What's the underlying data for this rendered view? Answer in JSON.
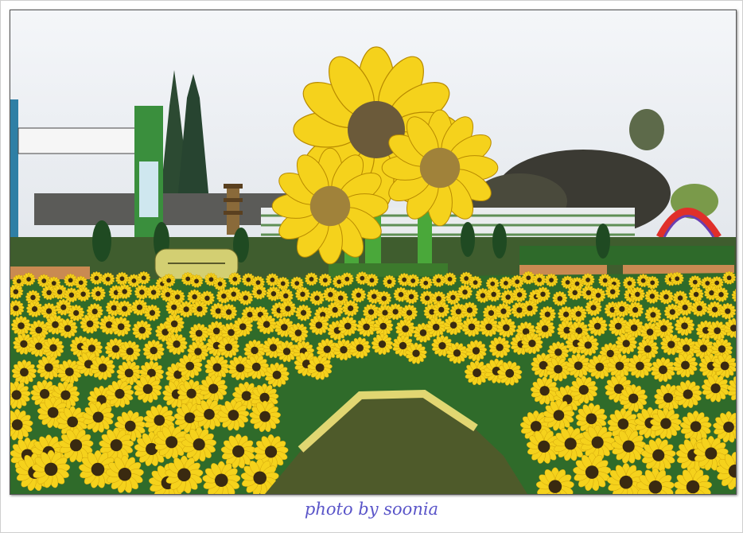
{
  "caption": {
    "text": "photo by soonia"
  },
  "scene": {
    "sky_color": "#eef1f4",
    "petal_color": "#f5d21c",
    "flower_center_color": "#3a2a10",
    "foliage_color": "#2f6b2a",
    "grass_color": "#5c6b2e",
    "arch_color": "#e0302a"
  }
}
